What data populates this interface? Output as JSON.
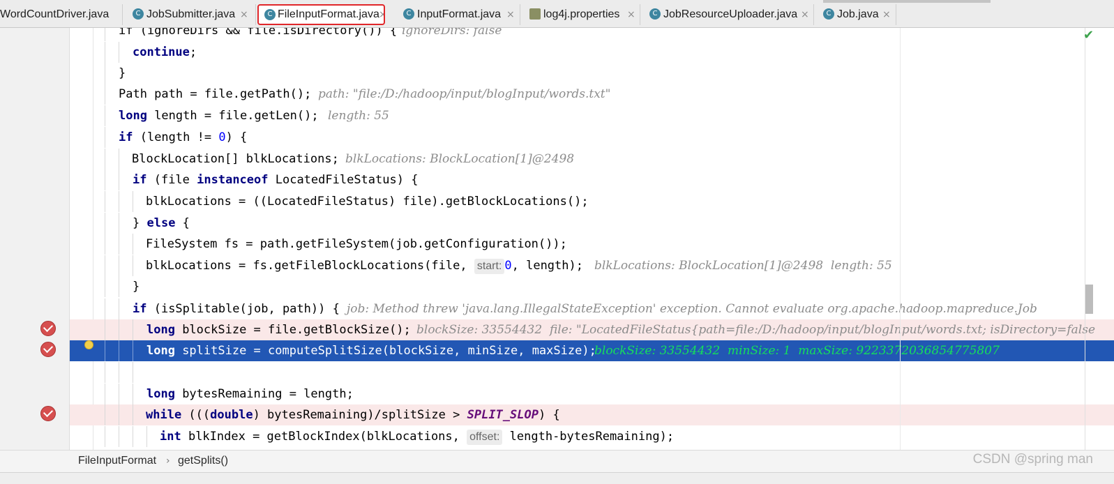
{
  "tabs": [
    {
      "label": "WordCountDriver.java",
      "icon": "java-class-icon",
      "active": false
    },
    {
      "label": "JobSubmitter.java",
      "icon": "java-class-icon",
      "active": false
    },
    {
      "label": "FileInputFormat.java",
      "icon": "java-class-icon",
      "active": true
    },
    {
      "label": "InputFormat.java",
      "icon": "java-class-icon",
      "active": false
    },
    {
      "label": "log4j.properties",
      "icon": "properties-file-icon",
      "active": false
    },
    {
      "label": "JobResourceUploader.java",
      "icon": "java-class-icon",
      "active": false
    },
    {
      "label": "Job.java",
      "icon": "java-class-icon",
      "active": false
    }
  ],
  "tab_icon_letter": "C",
  "tab_close": "×",
  "code": {
    "l1_code": "if (ignoreDirs && file.isDirectory()) {",
    "l1_hint": "ignoreDirs: false",
    "l2_kw": "continue",
    "l2_rest": ";",
    "l3": "}",
    "l4_code": "Path path = file.getPath();",
    "l4_hint": "path: \"file:/D:/hadoop/input/blogInput/words.txt\"",
    "l5_kw": "long",
    "l5_rest": " length = file.getLen();",
    "l5_hint": "length: 55",
    "l6_kw": "if",
    "l6_a": " (length != ",
    "l6_num": "0",
    "l6_b": ") {",
    "l7_code": "BlockLocation[] blkLocations;",
    "l7_hint": "blkLocations: BlockLocation[1]@2498",
    "l8_kw1": "if",
    "l8_a": " (file ",
    "l8_kw2": "instanceof",
    "l8_b": " LocatedFileStatus) {",
    "l9_code": "blkLocations = ((LocatedFileStatus) file).getBlockLocations();",
    "l10_a": "} ",
    "l10_kw": "else",
    "l10_b": " {",
    "l11_code": "FileSystem fs = path.getFileSystem(job.getConfiguration());",
    "l12_a": "blkLocations = fs.getFileBlockLocations(file, ",
    "l12_param": "start:",
    "l12_num": "0",
    "l12_b": ", length);",
    "l12_hint": "blkLocations: BlockLocation[1]@2498  length: 55",
    "l13": "}",
    "l14_kw": "if",
    "l14_rest": " (isSplitable(job, path)) {",
    "l14_hint": "job: Method threw 'java.lang.IllegalStateException' exception. Cannot evaluate org.apache.hadoop.mapreduce.Job",
    "l15_kw": "long",
    "l15_rest": " blockSize = file.getBlockSize();",
    "l15_hint": "blockSize: 33554432  file: \"LocatedFileStatus{path=file:/D:/hadoop/input/blogInput/words.txt; isDirectory=false",
    "l16_kw": "long",
    "l16_rest": " splitSize = computeSplitSize(blockSize, minSize, maxSize);",
    "l16_hint": "blockSize: 33554432  minSize: 1  maxSize: 9223372036854775807",
    "l18_kw": "long",
    "l18_rest": " bytesRemaining = length;",
    "l19_kw1": "while",
    "l19_a": " (((",
    "l19_kw2": "double",
    "l19_b": ") bytesRemaining)/splitSize > ",
    "l19_const": "SPLIT_SLOP",
    "l19_c": ") {",
    "l20_kw": "int",
    "l20_a": " blkIndex = getBlockIndex(blkLocations, ",
    "l20_param": "offset:",
    "l20_b": " length-bytesRemaining);"
  },
  "breadcrumb": {
    "class_name": "FileInputFormat",
    "separator": "›",
    "method": "getSplits()"
  },
  "status_check": "✔",
  "watermark": "CSDN @spring man",
  "colors": {
    "execution_line": "#2257b4",
    "breakpoint_line": "#fae8e8",
    "breakpoint": "#d64f4f",
    "keyword": "#000080",
    "hint_on_exec": "#15e05a",
    "active_tab_border": "#e0262a"
  }
}
